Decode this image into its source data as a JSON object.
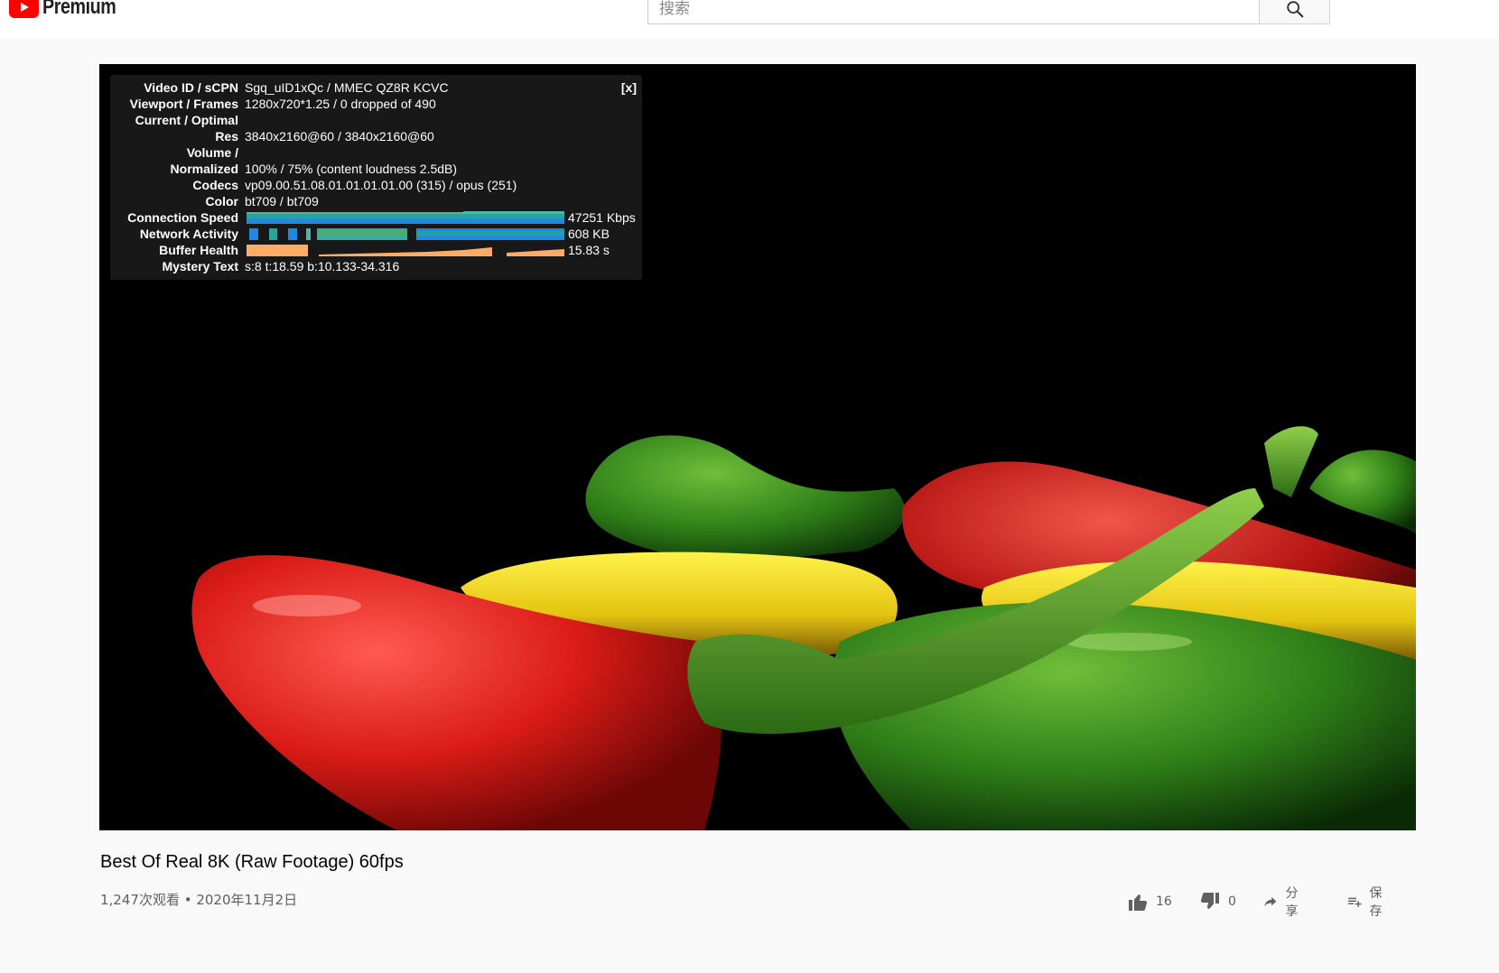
{
  "masthead": {
    "logo_text": "Premium",
    "search_placeholder": "搜索"
  },
  "stats_panel": {
    "close_label": "[x]",
    "rows": [
      {
        "label": "Video ID / sCPN",
        "value": "Sgq_uID1xQc / MMEC QZ8R KCVC"
      },
      {
        "label": "Viewport / Frames",
        "value": "1280x720*1.25 / 0 dropped of 490"
      },
      {
        "label": "Current / Optimal",
        "value": ""
      },
      {
        "label": "Res",
        "value": "3840x2160@60 / 3840x2160@60"
      },
      {
        "label": "Volume /",
        "value": ""
      },
      {
        "label": "Normalized",
        "value": "100% / 75% (content loudness 2.5dB)"
      },
      {
        "label": "Codecs",
        "value": "vp09.00.51.08.01.01.01.01.00 (315) / opus (251)"
      },
      {
        "label": "Color",
        "value": "bt709 / bt709"
      },
      {
        "label": "Connection Speed",
        "value": "47251 Kbps"
      },
      {
        "label": "Network Activity",
        "value": "608 KB"
      },
      {
        "label": "Buffer Health",
        "value": "15.83 s"
      },
      {
        "label": "Mystery Text",
        "value": "s:8 t:18.59 b:10.133-34.316"
      }
    ]
  },
  "video": {
    "title": "Best Of Real 8K (Raw Footage) 60fps",
    "meta": "1,247次观看 • 2020年11月2日"
  },
  "actions": {
    "like_count": "16",
    "dislike_count": "0",
    "share_label": "分享",
    "save_label": "保存"
  },
  "colors": {
    "youtube_red": "#ff0000",
    "graph_teal": "#26a69a",
    "graph_blue": "#1e88e5",
    "buffer_orange": "#ffab66"
  }
}
